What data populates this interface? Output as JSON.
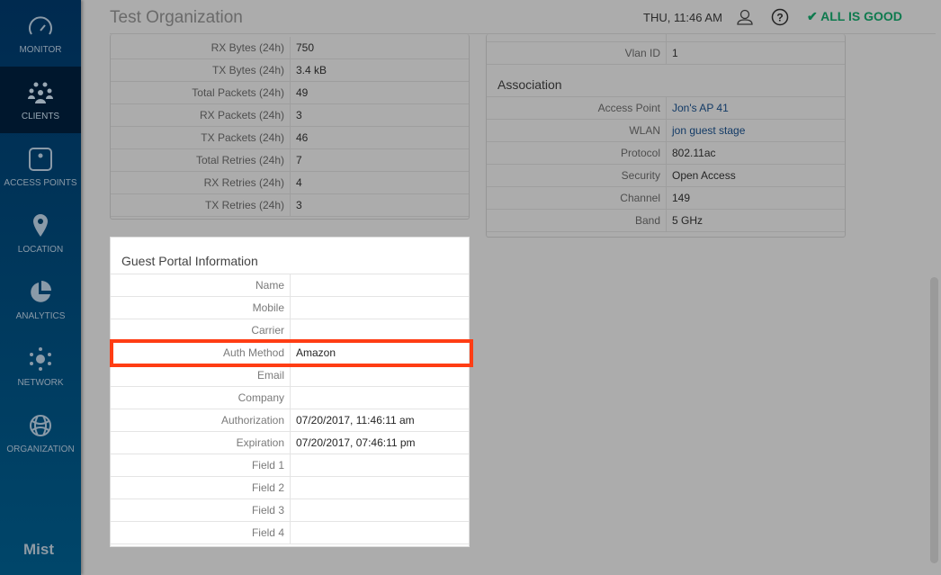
{
  "sidebar": {
    "items": [
      {
        "label": "MONITOR",
        "icon": "gauge-icon"
      },
      {
        "label": "CLIENTS",
        "icon": "clients-icon"
      },
      {
        "label": "ACCESS POINTS",
        "icon": "access-point-icon"
      },
      {
        "label": "LOCATION",
        "icon": "location-pin-icon"
      },
      {
        "label": "ANALYTICS",
        "icon": "pie-chart-icon"
      },
      {
        "label": "NETWORK",
        "icon": "network-icon"
      },
      {
        "label": "ORGANIZATION",
        "icon": "globe-icon"
      }
    ],
    "active": "CLIENTS",
    "logo": "Mist"
  },
  "header": {
    "title": "Test Organization",
    "time": "THU, 11:46 AM",
    "status": "ALL IS GOOD",
    "status_color": "#0e7a4e"
  },
  "stats": [
    {
      "label": "RX Bytes (24h)",
      "value": "750"
    },
    {
      "label": "TX Bytes (24h)",
      "value": "3.4 kB"
    },
    {
      "label": "Total Packets (24h)",
      "value": "49"
    },
    {
      "label": "RX Packets (24h)",
      "value": "3"
    },
    {
      "label": "TX Packets (24h)",
      "value": "46"
    },
    {
      "label": "Total Retries (24h)",
      "value": "7"
    },
    {
      "label": "RX Retries (24h)",
      "value": "4"
    },
    {
      "label": "TX Retries (24h)",
      "value": "3"
    }
  ],
  "network": {
    "vlan_label": "Vlan ID",
    "vlan_value": "1"
  },
  "association": {
    "title": "Association",
    "rows": [
      {
        "label": "Access Point",
        "value": "Jon's AP 41"
      },
      {
        "label": "WLAN",
        "value": "jon guest stage"
      },
      {
        "label": "Protocol",
        "value": "802.11ac"
      },
      {
        "label": "Security",
        "value": "Open Access"
      },
      {
        "label": "Channel",
        "value": "149"
      },
      {
        "label": "Band",
        "value": "5 GHz"
      }
    ]
  },
  "guest": {
    "title": "Guest Portal Information",
    "rows": [
      {
        "label": "Name",
        "value": ""
      },
      {
        "label": "Mobile",
        "value": ""
      },
      {
        "label": "Carrier",
        "value": ""
      },
      {
        "label": "Auth Method",
        "value": "Amazon"
      },
      {
        "label": "Email",
        "value": ""
      },
      {
        "label": "Company",
        "value": ""
      },
      {
        "label": "Authorization",
        "value": "07/20/2017, 11:46:11 am"
      },
      {
        "label": "Expiration",
        "value": "07/20/2017, 07:46:11 pm"
      },
      {
        "label": "Field 1",
        "value": ""
      },
      {
        "label": "Field 2",
        "value": ""
      },
      {
        "label": "Field 3",
        "value": ""
      },
      {
        "label": "Field 4",
        "value": ""
      }
    ]
  },
  "highlight_color": "#ff3d14"
}
